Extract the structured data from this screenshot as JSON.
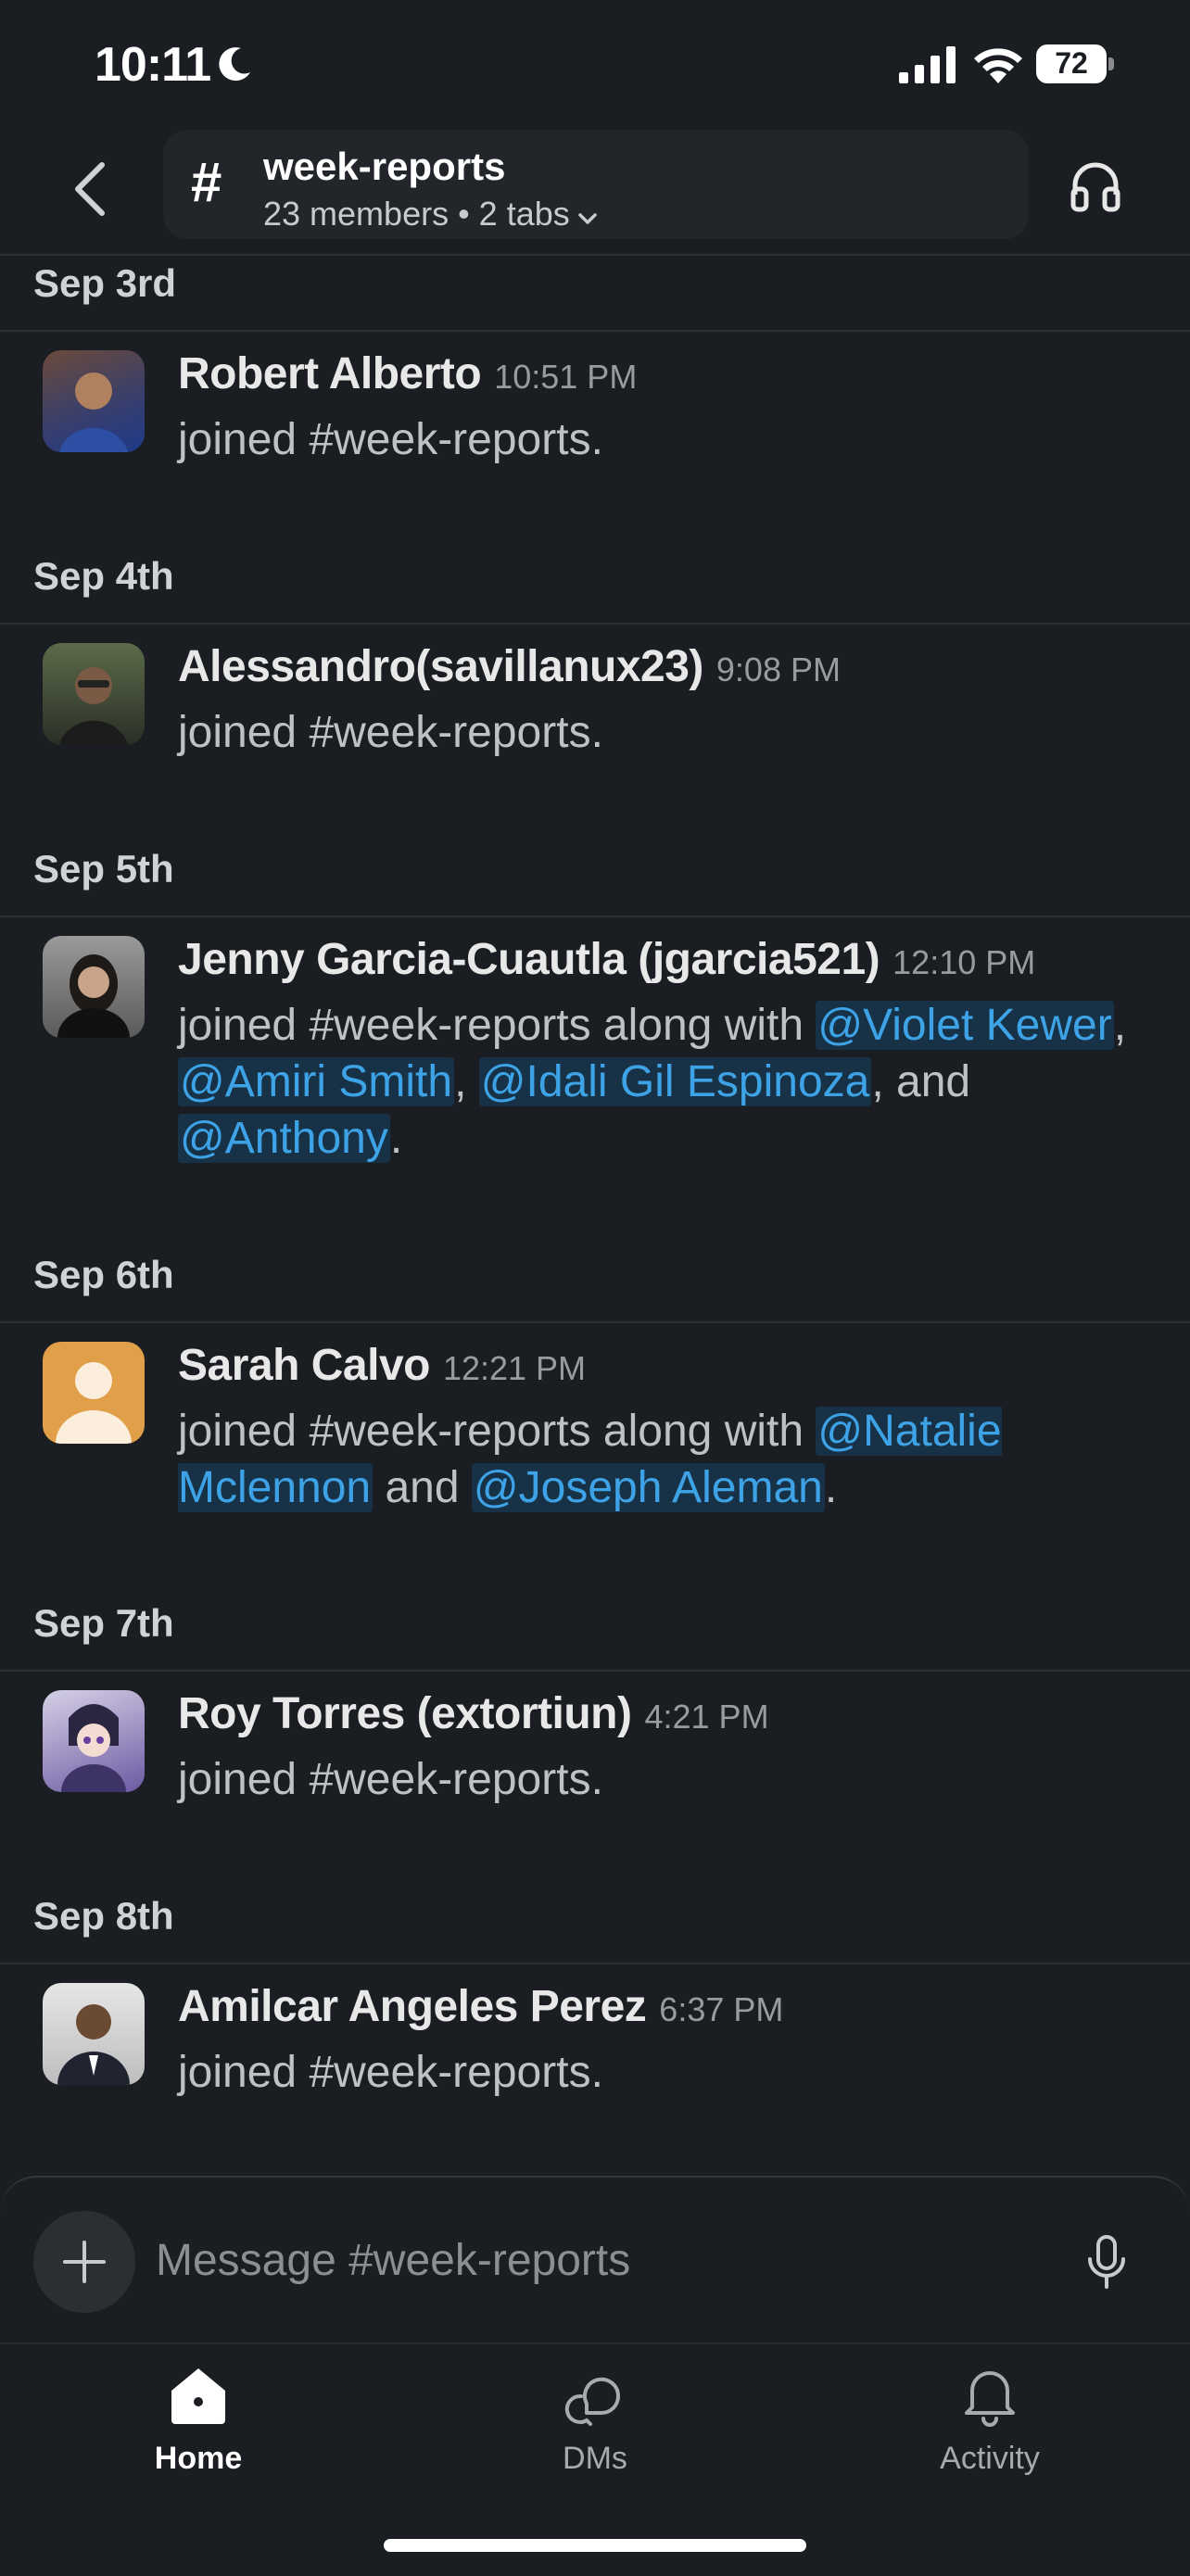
{
  "status_bar": {
    "time": "10:11",
    "battery": "72"
  },
  "header": {
    "channel_name": "week-reports",
    "meta": "23 members • 2 tabs"
  },
  "feed": [
    {
      "date": "Sep 3rd",
      "name": "Robert Alberto",
      "time": "10:51 PM",
      "text": "joined #week-reports."
    },
    {
      "date": "Sep 4th",
      "name": "Alessandro(savillanux23)",
      "time": "9:08 PM",
      "text": "joined #week-reports."
    },
    {
      "date": "Sep 5th",
      "name": "Jenny Garcia-Cuautla (jgarcia521)",
      "time": "12:10 PM",
      "text_prefix": "joined #week-reports along with ",
      "mentions": [
        "@Violet Kewer",
        "@Amiri Smith",
        "@Idali Gil Espinoza",
        "@Anthony"
      ],
      "sep1": ", ",
      "sep2": ", ",
      "sep3": ", and ",
      "end": "."
    },
    {
      "date": "Sep 6th",
      "name": "Sarah Calvo",
      "time": "12:21 PM",
      "text_prefix": "joined #week-reports along with ",
      "mentions": [
        "@Natalie Mclennon",
        "@Joseph Aleman"
      ],
      "sep1": " and ",
      "end": "."
    },
    {
      "date": "Sep 7th",
      "name": "Roy Torres (extortiun)",
      "time": "4:21 PM",
      "text": "joined #week-reports."
    },
    {
      "date": "Sep 8th",
      "name": "Amilcar Angeles Perez",
      "time": "6:37 PM",
      "text": "joined #week-reports."
    }
  ],
  "composer": {
    "placeholder": "Message #week-reports"
  },
  "tabs": [
    {
      "label": "Home",
      "icon": "home-icon",
      "active": true
    },
    {
      "label": "DMs",
      "icon": "dms-icon",
      "active": false
    },
    {
      "label": "Activity",
      "icon": "bell-icon",
      "active": false
    }
  ],
  "colors": {
    "background": "#1a1d21",
    "mention": "#3ea3e6",
    "mention_bg": "#173247"
  }
}
